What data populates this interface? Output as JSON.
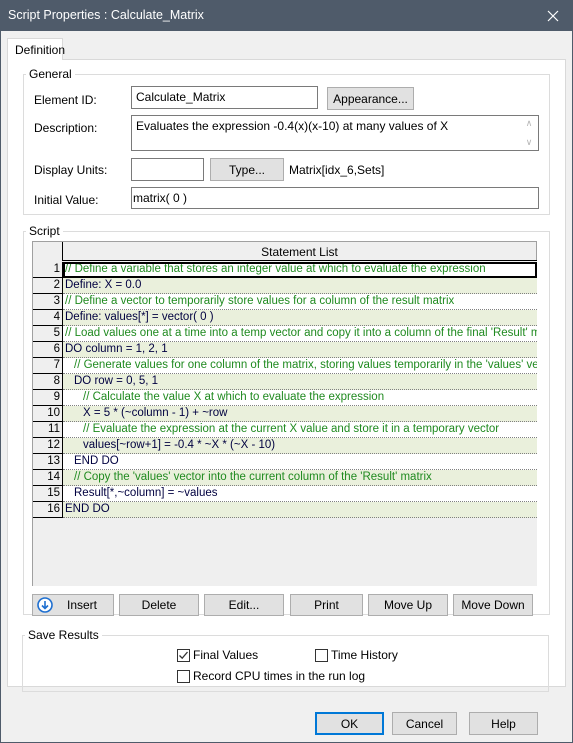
{
  "window": {
    "title": "Script Properties : Calculate_Matrix",
    "close_icon": "close-x-icon"
  },
  "tabs": [
    {
      "label": "Definition",
      "active": true
    }
  ],
  "general": {
    "legend": "General",
    "element_id_label": "Element ID:",
    "element_id_value": "Calculate_Matrix",
    "appearance_button": "Appearance...",
    "description_label": "Description:",
    "description_value": "Evaluates the expression -0.4(x)(x-10) at many values of X",
    "display_units_label": "Display Units:",
    "display_units_value": "",
    "type_button": "Type...",
    "type_value": "Matrix[idx_6,Sets]",
    "initial_value_label": "Initial Value:",
    "initial_value_value": "matrix( 0 )"
  },
  "script": {
    "legend": "Script",
    "column_header": "Statement List",
    "statements": [
      {
        "num": "1",
        "text": "// Define a variable that stores an integer value at which to evaluate the expression",
        "kind": "comment",
        "indent": 0,
        "selected": true
      },
      {
        "num": "2",
        "text": "Define: X = 0.0",
        "kind": "code",
        "indent": 0
      },
      {
        "num": "3",
        "text": "// Define a vector to temporarily store values for a column of the result matrix",
        "kind": "comment",
        "indent": 0
      },
      {
        "num": "4",
        "text": "Define: values[*] = vector( 0 )",
        "kind": "code",
        "indent": 0
      },
      {
        "num": "5",
        "text": "// Load values one at a time into a temp vector and copy it into a column of the final 'Result' matrix",
        "kind": "comment",
        "indent": 0
      },
      {
        "num": "6",
        "text": "DO column = 1, 2, 1",
        "kind": "code",
        "indent": 0
      },
      {
        "num": "7",
        "text": "// Generate values for one column of the matrix, storing values temporarily in the 'values' vector",
        "kind": "comment",
        "indent": 1
      },
      {
        "num": "8",
        "text": "DO row = 0, 5, 1",
        "kind": "code",
        "indent": 1
      },
      {
        "num": "9",
        "text": "// Calculate the value X at which to evaluate the expression",
        "kind": "comment",
        "indent": 2
      },
      {
        "num": "10",
        "text": "X = 5 * (~column - 1) + ~row",
        "kind": "code",
        "indent": 2
      },
      {
        "num": "11",
        "text": "// Evaluate the expression at the current X value and store it in a temporary vector",
        "kind": "comment",
        "indent": 2
      },
      {
        "num": "12",
        "text": "values[~row+1] = -0.4 * ~X * (~X - 10)",
        "kind": "code",
        "indent": 2
      },
      {
        "num": "13",
        "text": "END DO",
        "kind": "code",
        "indent": 1
      },
      {
        "num": "14",
        "text": "// Copy the 'values' vector into the current column of the 'Result' matrix",
        "kind": "comment",
        "indent": 1
      },
      {
        "num": "15",
        "text": "Result[*,~column] = ~values",
        "kind": "code",
        "indent": 1
      },
      {
        "num": "16",
        "text": "END DO",
        "kind": "code",
        "indent": 0
      }
    ],
    "buttons": {
      "insert": "Insert",
      "insert_icon": "arrow-down-circle-icon",
      "delete": "Delete",
      "edit": "Edit...",
      "print": "Print",
      "move_up": "Move Up",
      "move_down": "Move Down"
    }
  },
  "save_results": {
    "legend": "Save Results",
    "final_values_label": "Final Values",
    "final_values_checked": true,
    "time_history_label": "Time History",
    "time_history_checked": false,
    "cpu_times_label": "Record CPU times in the run log",
    "cpu_times_checked": false
  },
  "dialog_buttons": {
    "ok": "OK",
    "cancel": "Cancel",
    "help": "Help"
  },
  "colors": {
    "titlebar": "#4f5b6a",
    "comment_text": "#1f8a1f",
    "shaded_row": "#eaf0dc",
    "ok_focus_border": "#0078d7"
  }
}
